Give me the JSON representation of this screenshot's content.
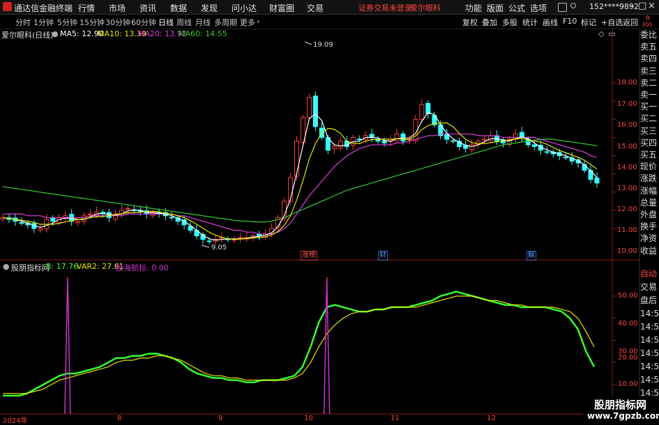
{
  "app": {
    "title": "通达信金融终端",
    "menu": [
      "行情",
      "市场",
      "资讯",
      "数据",
      "发现",
      "问小达",
      "财富圈",
      "交易"
    ],
    "account_status": "证券交易未登录",
    "stock_name": "爱尔眼科",
    "right_menu": [
      "功能",
      "版面",
      "公式",
      "选项"
    ],
    "user": "152****9892"
  },
  "toolbar": {
    "periods": [
      "分时",
      "1分钟",
      "5分钟",
      "15分钟",
      "30分钟",
      "60分钟",
      "日线",
      "周线",
      "月线",
      "多周期",
      "更多"
    ],
    "active_period": "日线",
    "right_buttons": [
      "复权",
      "叠加",
      "多股",
      "统计",
      "画线",
      "F10",
      "标记",
      "+自选",
      "返回"
    ]
  },
  "kline_panel": {
    "title": "爱尔眼科(日线)",
    "ma": [
      {
        "label": "MA5: 12.90",
        "color": "#ffffff"
      },
      {
        "label": "MA10: 13.39",
        "color": "#e6e600"
      },
      {
        "label": "MA20: 13.92",
        "color": "#e040e0"
      },
      {
        "label": "MA60: 14.55",
        "color": "#33cc33"
      }
    ],
    "high_label": "19.09",
    "low_label": "9.05",
    "y_ticks": [
      "18.00",
      "17.00",
      "16.00",
      "15.00",
      "14.00",
      "13.00",
      "12.00",
      "11.00",
      "10.00"
    ],
    "event_tags": [
      {
        "text": "涨榜",
        "color": "#ff5555"
      },
      {
        "text": "财",
        "color": "#5599ff"
      },
      {
        "text": "解",
        "color": "#5599ff"
      }
    ]
  },
  "indicator_panel": {
    "title": "股朋指标网",
    "b_label": "B: 17.76",
    "var2_label": "VAR2: 27.61",
    "signal_label": "股海航标: 0.00",
    "y_ticks": [
      "50.00",
      "40.00",
      "30.00",
      "20.00",
      "10.00"
    ]
  },
  "x_axis": [
    "2024年",
    "8",
    "9",
    "10",
    "11",
    "12"
  ],
  "right_panel": {
    "corner": [
      "R",
      "300"
    ],
    "top_items": [
      "委比",
      "卖五",
      "卖四",
      "卖三",
      "卖二",
      "卖一",
      "买一",
      "买二",
      "买三",
      "买四",
      "买五",
      "现价",
      "涨跌",
      "涨幅",
      "总量",
      "外盘",
      "换手",
      "净资",
      "收益"
    ],
    "bottom_items": [
      "自动",
      "交易",
      "盘后",
      "14:56",
      "14:56",
      "14:56",
      "14:56",
      "14:56",
      "14:56",
      "14:56",
      "14:56"
    ]
  },
  "watermark": {
    "main": "股朋指标网",
    "sub": "www.7gpzb.com"
  },
  "chart_data": [
    {
      "type": "candlestick",
      "title": "爱尔眼科(日线)",
      "ylim": [
        9.5,
        19.5
      ],
      "series": [
        {
          "name": "MA5",
          "values": [
            12.9
          ],
          "color": "#ffffff"
        },
        {
          "name": "MA10",
          "values": [
            13.39
          ],
          "color": "#e6e600"
        },
        {
          "name": "MA20",
          "values": [
            13.92
          ],
          "color": "#e040e0"
        },
        {
          "name": "MA60",
          "values": [
            14.55
          ],
          "color": "#33cc33"
        }
      ],
      "annotations": [
        "19.09",
        "9.05"
      ],
      "close_path": [
        10.6,
        10.5,
        10.4,
        10.3,
        10.2,
        10.0,
        10.0,
        10.5,
        10.4,
        10.6,
        10.7,
        10.4,
        10.4,
        10.7,
        10.8,
        10.9,
        10.8,
        10.6,
        10.8,
        11.0,
        11.1,
        11.0,
        10.9,
        10.8,
        10.9,
        10.8,
        10.7,
        10.6,
        10.4,
        10.2,
        9.9,
        9.6,
        9.4,
        9.3,
        9.4,
        9.5,
        9.4,
        9.4,
        9.5,
        9.5,
        9.6,
        9.6,
        9.7,
        10.0,
        10.6,
        11.5,
        12.8,
        14.8,
        16.1,
        17.2,
        15.6,
        15.0,
        14.3,
        14.5,
        14.8,
        14.5,
        15.0,
        14.9,
        15.1,
        15.0,
        14.8,
        14.7,
        14.9,
        15.2,
        14.8,
        14.9,
        16.0,
        16.8,
        16.3,
        15.7,
        15.1,
        14.9,
        14.8,
        14.5,
        14.4,
        14.6,
        14.8,
        14.9,
        15.1,
        14.8,
        14.7,
        14.9,
        15.2,
        15.0,
        14.6,
        14.5,
        14.3,
        14.2,
        14.1,
        14.0,
        13.9,
        13.7,
        13.6,
        13.2,
        12.7,
        12.5
      ],
      "ma20_path": [
        10.8,
        10.8,
        10.8,
        10.8,
        10.7,
        10.7,
        10.7,
        10.6,
        10.6,
        10.6,
        10.6,
        10.6,
        10.6,
        10.6,
        10.7,
        10.7,
        10.7,
        10.7,
        10.7,
        10.7,
        10.8,
        10.8,
        10.8,
        10.8,
        10.8,
        10.8,
        10.8,
        10.8,
        10.7,
        10.7,
        10.6,
        10.5,
        10.4,
        10.3,
        10.2,
        10.1,
        10.0,
        9.9,
        9.9,
        9.8,
        9.8,
        9.7,
        9.7,
        9.7,
        9.8,
        10.0,
        10.3,
        10.8,
        11.3,
        11.8,
        12.2,
        12.6,
        13.0,
        13.4,
        13.7,
        14.0,
        14.2,
        14.4,
        14.5,
        14.6,
        14.6,
        14.6,
        14.6,
        14.7,
        14.7,
        14.8,
        14.9,
        15.0,
        15.1,
        15.1,
        15.2,
        15.2,
        15.2,
        15.2,
        15.2,
        15.2,
        15.1,
        15.1,
        15.1,
        15.1,
        15.0,
        15.0,
        15.0,
        15.0,
        15.0,
        15.0,
        14.9,
        14.8,
        14.7,
        14.6,
        14.5,
        14.4,
        14.3,
        14.2,
        14.0,
        13.9
      ],
      "ma60_path": [
        12.3,
        12.25,
        12.2,
        12.15,
        12.1,
        12.05,
        12.0,
        11.95,
        11.9,
        11.85,
        11.8,
        11.75,
        11.7,
        11.65,
        11.6,
        11.55,
        11.5,
        11.45,
        11.4,
        11.35,
        11.3,
        11.25,
        11.2,
        11.15,
        11.1,
        11.05,
        11.0,
        10.95,
        10.9,
        10.85,
        10.8,
        10.75,
        10.7,
        10.65,
        10.6,
        10.55,
        10.5,
        10.45,
        10.42,
        10.4,
        10.38,
        10.36,
        10.36,
        10.4,
        10.5,
        10.6,
        10.75,
        10.9,
        11.05,
        11.2,
        11.35,
        11.5,
        11.65,
        11.8,
        11.95,
        12.1,
        12.2,
        12.3,
        12.4,
        12.5,
        12.6,
        12.7,
        12.8,
        12.9,
        13.0,
        13.1,
        13.2,
        13.3,
        13.4,
        13.5,
        13.6,
        13.7,
        13.8,
        13.9,
        14.0,
        14.1,
        14.2,
        14.3,
        14.4,
        14.5,
        14.6,
        14.65,
        14.7,
        14.75,
        14.8,
        14.85,
        14.9,
        14.92,
        14.9,
        14.85,
        14.8,
        14.75,
        14.7,
        14.65,
        14.6,
        14.55
      ]
    },
    {
      "type": "line",
      "title": "股朋指标网",
      "ylim": [
        5,
        55
      ],
      "series": [
        {
          "name": "B",
          "color": "#33ff33",
          "values": [
            5,
            5,
            5,
            6,
            8,
            10,
            12,
            14,
            15,
            15,
            16,
            17,
            18,
            20,
            22,
            22,
            23,
            23,
            24,
            24,
            23,
            22,
            20,
            17,
            15,
            14,
            13,
            13,
            12,
            12,
            11,
            11,
            12,
            12,
            12,
            13,
            14,
            18,
            27,
            38,
            45,
            46,
            45,
            44,
            43,
            43,
            44,
            44,
            45,
            45,
            45,
            46,
            47,
            48,
            50,
            51,
            52,
            51,
            50,
            49,
            48,
            47,
            46,
            46,
            45,
            45,
            45,
            45,
            44,
            43,
            40,
            35,
            25,
            18
          ]
        },
        {
          "name": "VAR2",
          "color": "#e6e600",
          "values": [
            6,
            6,
            6,
            6,
            7,
            8,
            10,
            12,
            13,
            14,
            15,
            16,
            17,
            18,
            20,
            21,
            21,
            22,
            22,
            23,
            23,
            22,
            21,
            19,
            17,
            15,
            14,
            14,
            13,
            13,
            12,
            12,
            12,
            12,
            12,
            12,
            13,
            15,
            20,
            27,
            33,
            37,
            40,
            42,
            43,
            43,
            44,
            44,
            45,
            45,
            45,
            45,
            46,
            47,
            48,
            49,
            50,
            50,
            50,
            49,
            48,
            48,
            47,
            46,
            46,
            45,
            45,
            45,
            45,
            44,
            43,
            40,
            34,
            27
          ]
        }
      ],
      "signal": {
        "name": "股海航标",
        "value": 0.0,
        "spikes_at_index": [
          6,
          38
        ],
        "color": "#cc33cc"
      }
    }
  ]
}
